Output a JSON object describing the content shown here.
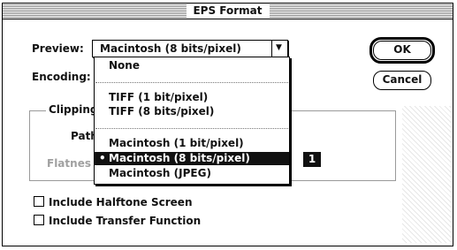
{
  "window": {
    "title": "EPS Format"
  },
  "preview": {
    "label": "Preview:",
    "selected": "Macintosh (8 bits/pixel)",
    "arrow_icon": "triangle-down-icon",
    "options": [
      "None",
      "TIFF (1 bit/pixel)",
      "TIFF (8 bits/pixel)",
      "Macintosh (1 bit/pixel)",
      "Macintosh (8 bits/pixel)",
      "Macintosh (JPEG)"
    ],
    "selected_marker": "•"
  },
  "encoding": {
    "label": "Encoding:"
  },
  "clipping": {
    "group_label": "Clipping",
    "path_label": "Path",
    "flatness_label": "Flatnes"
  },
  "buttons": {
    "ok": "OK",
    "cancel": "Cancel"
  },
  "callout": "1",
  "checkboxes": [
    {
      "label": "Include Halftone Screen",
      "checked": false
    },
    {
      "label": "Include Transfer Function",
      "checked": false
    }
  ]
}
